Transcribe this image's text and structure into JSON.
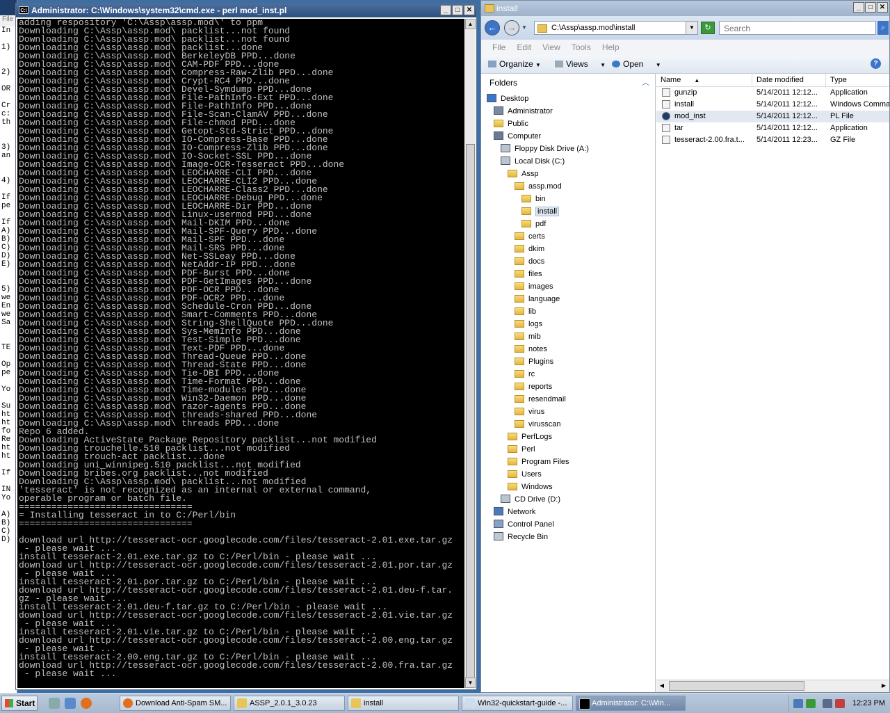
{
  "background_window": {
    "menu_fragment": "File",
    "left_text": "In\n\n1)\n\n\n2)\n\nOR\n\nCr\nc:\nth\n\n\n3)\nan\n\n\n4)\n\nIf\npe\n\nIf\nA)\nB)\nC)\nD)\nE)\n\n\n5)\nwe\nEn\nwe\nSa\n\n\nTE\n\nOp\npe\n\nYo\n\nSu\nht\nht\nfo\nRe\nht\nht\n\nIf\n\nIN\nYo\n\nA)\nB)\nC)\nD)"
  },
  "cmd": {
    "title": "Administrator: C:\\Windows\\system32\\cmd.exe - perl  mod_inst.pl",
    "icon_label": "C:\\",
    "console_text": "adding respository 'C:\\Assp\\assp.mod\\' to ppm\nDownloading C:\\Assp\\assp.mod\\ packlist...not found\nDownloading C:\\Assp\\assp.mod\\ packlist...not found\nDownloading C:\\Assp\\assp.mod\\ packlist...done\nDownloading C:\\Assp\\assp.mod\\ BerkeleyDB PPD...done\nDownloading C:\\Assp\\assp.mod\\ CAM-PDF PPD...done\nDownloading C:\\Assp\\assp.mod\\ Compress-Raw-Zlib PPD...done\nDownloading C:\\Assp\\assp.mod\\ Crypt-RC4 PPD...done\nDownloading C:\\Assp\\assp.mod\\ Devel-Symdump PPD...done\nDownloading C:\\Assp\\assp.mod\\ File-PathInfo-Ext PPD...done\nDownloading C:\\Assp\\assp.mod\\ File-PathInfo PPD...done\nDownloading C:\\Assp\\assp.mod\\ File-Scan-ClamAV PPD...done\nDownloading C:\\Assp\\assp.mod\\ File-chmod PPD...done\nDownloading C:\\Assp\\assp.mod\\ Getopt-Std-Strict PPD...done\nDownloading C:\\Assp\\assp.mod\\ IO-Compress-Base PPD...done\nDownloading C:\\Assp\\assp.mod\\ IO-Compress-Zlib PPD...done\nDownloading C:\\Assp\\assp.mod\\ IO-Socket-SSL PPD...done\nDownloading C:\\Assp\\assp.mod\\ Image-OCR-Tesseract PPD...done\nDownloading C:\\Assp\\assp.mod\\ LEOCHARRE-CLI PPD...done\nDownloading C:\\Assp\\assp.mod\\ LEOCHARRE-CLI2 PPD...done\nDownloading C:\\Assp\\assp.mod\\ LEOCHARRE-Class2 PPD...done\nDownloading C:\\Assp\\assp.mod\\ LEOCHARRE-Debug PPD...done\nDownloading C:\\Assp\\assp.mod\\ LEOCHARRE-Dir PPD...done\nDownloading C:\\Assp\\assp.mod\\ Linux-usermod PPD...done\nDownloading C:\\Assp\\assp.mod\\ Mail-DKIM PPD...done\nDownloading C:\\Assp\\assp.mod\\ Mail-SPF-Query PPD...done\nDownloading C:\\Assp\\assp.mod\\ Mail-SPF PPD...done\nDownloading C:\\Assp\\assp.mod\\ Mail-SRS PPD...done\nDownloading C:\\Assp\\assp.mod\\ Net-SSLeay PPD...done\nDownloading C:\\Assp\\assp.mod\\ NetAddr-IP PPD...done\nDownloading C:\\Assp\\assp.mod\\ PDF-Burst PPD...done\nDownloading C:\\Assp\\assp.mod\\ PDF-GetImages PPD...done\nDownloading C:\\Assp\\assp.mod\\ PDF-OCR PPD...done\nDownloading C:\\Assp\\assp.mod\\ PDF-OCR2 PPD...done\nDownloading C:\\Assp\\assp.mod\\ Schedule-Cron PPD...done\nDownloading C:\\Assp\\assp.mod\\ Smart-Comments PPD...done\nDownloading C:\\Assp\\assp.mod\\ String-ShellQuote PPD...done\nDownloading C:\\Assp\\assp.mod\\ Sys-MemInfo PPD...done\nDownloading C:\\Assp\\assp.mod\\ Test-Simple PPD...done\nDownloading C:\\Assp\\assp.mod\\ Text-PDF PPD...done\nDownloading C:\\Assp\\assp.mod\\ Thread-Queue PPD...done\nDownloading C:\\Assp\\assp.mod\\ Thread-State PPD...done\nDownloading C:\\Assp\\assp.mod\\ Tie-DBI PPD...done\nDownloading C:\\Assp\\assp.mod\\ Time-Format PPD...done\nDownloading C:\\Assp\\assp.mod\\ Time-modules PPD...done\nDownloading C:\\Assp\\assp.mod\\ Win32-Daemon PPD...done\nDownloading C:\\Assp\\assp.mod\\ razor-agents PPD...done\nDownloading C:\\Assp\\assp.mod\\ threads-shared PPD...done\nDownloading C:\\Assp\\assp.mod\\ threads PPD...done\nRepo 6 added.\nDownloading ActiveState Package Repository packlist...not modified\nDownloading trouchelle.510 packlist...not modified\nDownloading trouch-act packlist...done\nDownloading uni_winnipeg.510 packlist...not modified\nDownloading bribes.org packlist...not modified\nDownloading C:\\Assp\\assp.mod\\ packlist...not modified\n'tesseract' is not recognized as an internal or external command,\noperable program or batch file.\n================================\n= Installing tesseract in to C:/Perl/bin\n================================\n\ndownload url http://tesseract-ocr.googlecode.com/files/tesseract-2.01.exe.tar.gz\n - please wait ...\ninstall tesseract-2.01.exe.tar.gz to C:/Perl/bin - please wait ...\ndownload url http://tesseract-ocr.googlecode.com/files/tesseract-2.01.por.tar.gz\n - please wait ...\ninstall tesseract-2.01.por.tar.gz to C:/Perl/bin - please wait ...\ndownload url http://tesseract-ocr.googlecode.com/files/tesseract-2.01.deu-f.tar.\ngz - please wait ...\ninstall tesseract-2.01.deu-f.tar.gz to C:/Perl/bin - please wait ...\ndownload url http://tesseract-ocr.googlecode.com/files/tesseract-2.01.vie.tar.gz\n - please wait ...\ninstall tesseract-2.01.vie.tar.gz to C:/Perl/bin - please wait ...\ndownload url http://tesseract-ocr.googlecode.com/files/tesseract-2.00.eng.tar.gz\n - please wait ...\ninstall tesseract-2.00.eng.tar.gz to C:/Perl/bin - please wait ...\ndownload url http://tesseract-ocr.googlecode.com/files/tesseract-2.00.fra.tar.gz\n - please wait ..."
  },
  "explorer": {
    "title": "install",
    "address": "C:\\Assp\\assp.mod\\install",
    "search_placeholder": "Search",
    "menu": [
      "File",
      "Edit",
      "View",
      "Tools",
      "Help"
    ],
    "toolbar": {
      "organize": "Organize",
      "views": "Views",
      "open": "Open"
    },
    "folders_header": "Folders",
    "tree": [
      {
        "label": "Desktop",
        "type": "desktop"
      },
      {
        "label": "Administrator",
        "type": "user"
      },
      {
        "label": "Public",
        "type": "folder"
      },
      {
        "label": "Computer",
        "type": "computer"
      },
      {
        "label": "Floppy Disk Drive (A:)",
        "type": "drive"
      },
      {
        "label": "Local Disk (C:)",
        "type": "drive"
      },
      {
        "label": "Assp",
        "type": "folder"
      },
      {
        "label": "assp.mod",
        "type": "folder"
      },
      {
        "label": "bin",
        "type": "folder"
      },
      {
        "label": "install",
        "type": "folder"
      },
      {
        "label": "pdf",
        "type": "folder"
      },
      {
        "label": "certs",
        "type": "folder"
      },
      {
        "label": "dkim",
        "type": "folder"
      },
      {
        "label": "docs",
        "type": "folder"
      },
      {
        "label": "files",
        "type": "folder"
      },
      {
        "label": "images",
        "type": "folder"
      },
      {
        "label": "language",
        "type": "folder"
      },
      {
        "label": "lib",
        "type": "folder"
      },
      {
        "label": "logs",
        "type": "folder"
      },
      {
        "label": "mib",
        "type": "folder"
      },
      {
        "label": "notes",
        "type": "folder"
      },
      {
        "label": "Plugins",
        "type": "folder"
      },
      {
        "label": "rc",
        "type": "folder"
      },
      {
        "label": "reports",
        "type": "folder"
      },
      {
        "label": "resendmail",
        "type": "folder"
      },
      {
        "label": "virus",
        "type": "folder"
      },
      {
        "label": "virusscan",
        "type": "folder"
      },
      {
        "label": "PerfLogs",
        "type": "folder"
      },
      {
        "label": "Perl",
        "type": "folder"
      },
      {
        "label": "Program Files",
        "type": "folder"
      },
      {
        "label": "Users",
        "type": "folder"
      },
      {
        "label": "Windows",
        "type": "folder"
      },
      {
        "label": "CD Drive (D:)",
        "type": "drive"
      },
      {
        "label": "Network",
        "type": "network"
      },
      {
        "label": "Control Panel",
        "type": "control"
      },
      {
        "label": "Recycle Bin",
        "type": "recycle"
      }
    ],
    "columns": [
      "Name",
      "Date modified",
      "Type"
    ],
    "files": [
      {
        "name": "gunzip",
        "date": "5/14/2011 12:12...",
        "type": "Application"
      },
      {
        "name": "install",
        "date": "5/14/2011 12:12...",
        "type": "Windows Comma"
      },
      {
        "name": "mod_inst",
        "date": "5/14/2011 12:12...",
        "type": "PL File"
      },
      {
        "name": "tar",
        "date": "5/14/2011 12:12...",
        "type": "Application"
      },
      {
        "name": "tesseract-2.00.fra.t...",
        "date": "5/14/2011 12:23...",
        "type": "GZ File"
      }
    ]
  },
  "taskbar": {
    "start": "Start",
    "buttons": [
      "Download Anti-Spam SM...",
      "ASSP_2.0.1_3.0.23",
      "install",
      "Win32-quickstart-guide -...",
      "Administrator: C:\\Win..."
    ],
    "clock": "12:23 PM"
  }
}
